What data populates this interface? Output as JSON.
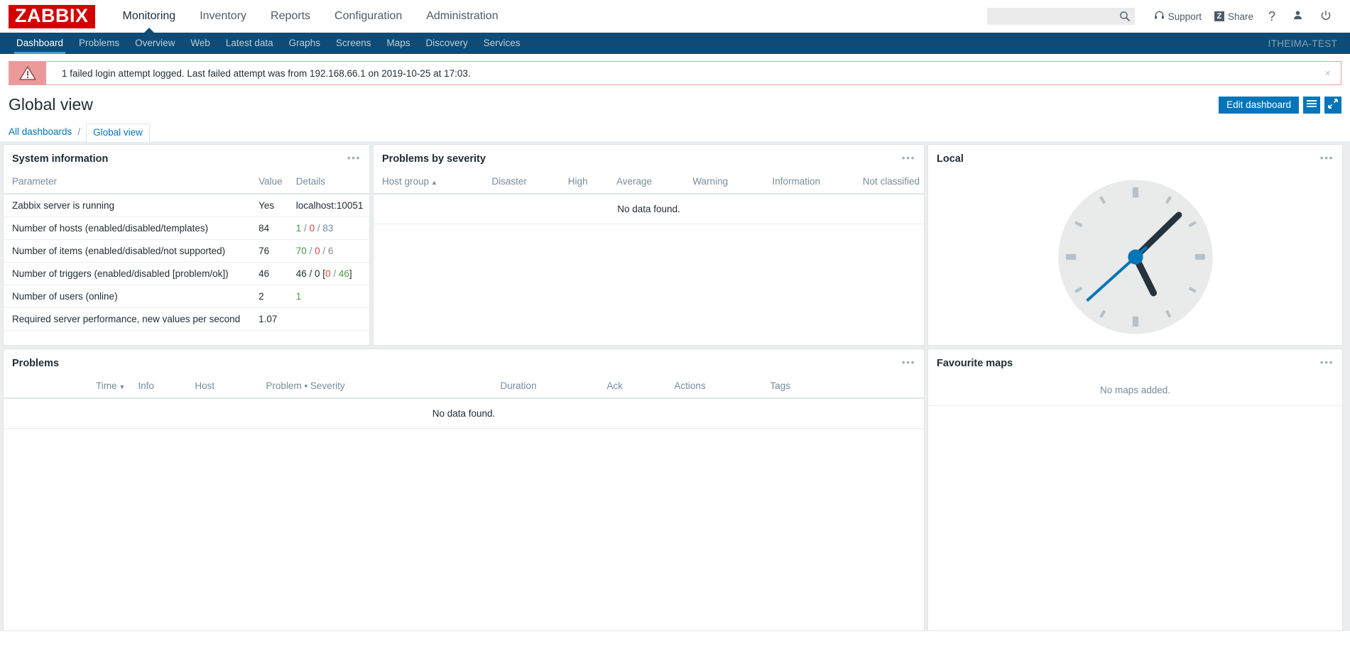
{
  "brand": {
    "logo_text": "ZABBIX"
  },
  "mainnav": {
    "items": [
      {
        "label": "Monitoring",
        "active": true
      },
      {
        "label": "Inventory",
        "active": false
      },
      {
        "label": "Reports",
        "active": false
      },
      {
        "label": "Configuration",
        "active": false
      },
      {
        "label": "Administration",
        "active": false
      }
    ]
  },
  "topright": {
    "search_placeholder": "",
    "search_value": "",
    "search_icon": "search-icon",
    "support_label": "Support",
    "support_icon": "headset-icon",
    "share_label": "Share",
    "share_icon": "z-badge-icon",
    "help_label": "?",
    "user_icon": "user-icon",
    "signout_icon": "power-icon"
  },
  "subnav": {
    "items": [
      {
        "label": "Dashboard",
        "active": true
      },
      {
        "label": "Problems",
        "active": false
      },
      {
        "label": "Overview",
        "active": false
      },
      {
        "label": "Web",
        "active": false
      },
      {
        "label": "Latest data",
        "active": false
      },
      {
        "label": "Graphs",
        "active": false
      },
      {
        "label": "Screens",
        "active": false
      },
      {
        "label": "Maps",
        "active": false
      },
      {
        "label": "Discovery",
        "active": false
      },
      {
        "label": "Services",
        "active": false
      }
    ],
    "server_name": "ITHEIMA-TEST"
  },
  "alert": {
    "icon": "warning-triangle-icon",
    "message": "1 failed login attempt logged. Last failed attempt was from 192.168.66.1 on 2019-10-25 at 17:03.",
    "close_label": "×"
  },
  "page": {
    "title": "Global view",
    "edit_button": "Edit dashboard",
    "menu_icon": "hamburger-menu-icon",
    "kiosk_icon": "expand-arrows-icon"
  },
  "breadcrumb": {
    "all_dashboards": "All dashboards",
    "separator": "/",
    "current": "Global view"
  },
  "widgets": {
    "system_information": {
      "title": "System information",
      "menu_icon": "widget-menu-icon",
      "columns": [
        "Parameter",
        "Value",
        "Details"
      ],
      "rows": [
        {
          "parameter": "Zabbix server is running",
          "value": "Yes",
          "value_color": "green",
          "details": [
            {
              "text": "localhost:10051",
              "color": "dark"
            }
          ]
        },
        {
          "parameter": "Number of hosts (enabled/disabled/templates)",
          "value": "84",
          "value_color": "dark",
          "details": [
            {
              "text": "1",
              "color": "green"
            },
            {
              "text": " / ",
              "color": "gray"
            },
            {
              "text": "0",
              "color": "red"
            },
            {
              "text": " / ",
              "color": "gray"
            },
            {
              "text": "83",
              "color": "gray"
            }
          ]
        },
        {
          "parameter": "Number of items (enabled/disabled/not supported)",
          "value": "76",
          "value_color": "dark",
          "details": [
            {
              "text": "70",
              "color": "green"
            },
            {
              "text": " / ",
              "color": "gray"
            },
            {
              "text": "0",
              "color": "red"
            },
            {
              "text": " / ",
              "color": "gray"
            },
            {
              "text": "6",
              "color": "gray"
            }
          ]
        },
        {
          "parameter": "Number of triggers (enabled/disabled [problem/ok])",
          "value": "46",
          "value_color": "dark",
          "details": [
            {
              "text": "46 / 0 [",
              "color": "dark"
            },
            {
              "text": "0",
              "color": "red"
            },
            {
              "text": " / ",
              "color": "gray"
            },
            {
              "text": "46",
              "color": "green"
            },
            {
              "text": "]",
              "color": "dark"
            }
          ]
        },
        {
          "parameter": "Number of users (online)",
          "value": "2",
          "value_color": "dark",
          "details": [
            {
              "text": "1",
              "color": "green"
            }
          ]
        },
        {
          "parameter": "Required server performance, new values per second",
          "value": "1.07",
          "value_color": "dark",
          "details": []
        }
      ]
    },
    "problems_by_severity": {
      "title": "Problems by severity",
      "menu_icon": "widget-menu-icon",
      "columns": [
        {
          "label": "Host group",
          "sorted": "asc",
          "sort_glyph": "▲"
        },
        {
          "label": "Disaster",
          "sorted": "",
          "sort_glyph": ""
        },
        {
          "label": "High",
          "sorted": "",
          "sort_glyph": ""
        },
        {
          "label": "Average",
          "sorted": "",
          "sort_glyph": ""
        },
        {
          "label": "Warning",
          "sorted": "",
          "sort_glyph": ""
        },
        {
          "label": "Information",
          "sorted": "",
          "sort_glyph": ""
        },
        {
          "label": "Not classified",
          "sorted": "",
          "sort_glyph": ""
        }
      ],
      "empty_text": "No data found.",
      "rows": []
    },
    "local_clock": {
      "title": "Local",
      "menu_icon": "widget-menu-icon",
      "clock": {
        "hour": 5,
        "minute": 7,
        "second": 38
      }
    },
    "problems": {
      "title": "Problems",
      "menu_icon": "widget-menu-icon",
      "columns": [
        {
          "label": "Time",
          "sorted": "desc",
          "sort_glyph": "▼"
        },
        {
          "label": "Info",
          "sorted": "",
          "sort_glyph": ""
        },
        {
          "label": "Host",
          "sorted": "",
          "sort_glyph": ""
        },
        {
          "label": "Problem • Severity",
          "sorted": "",
          "sort_glyph": ""
        },
        {
          "label": "Duration",
          "sorted": "",
          "sort_glyph": ""
        },
        {
          "label": "Ack",
          "sorted": "",
          "sort_glyph": ""
        },
        {
          "label": "Actions",
          "sorted": "",
          "sort_glyph": ""
        },
        {
          "label": "Tags",
          "sorted": "",
          "sort_glyph": ""
        }
      ],
      "empty_text": "No data found.",
      "rows": []
    },
    "favourite_maps": {
      "title": "Favourite maps",
      "menu_icon": "widget-menu-icon",
      "empty_text": "No maps added."
    }
  },
  "colors": {
    "brand_red": "#d40000",
    "nav_blue": "#0f4b75",
    "accent_blue": "#0275b8",
    "link_blue": "#0275b8",
    "alert_pink": "#eb9a9a",
    "green": "#4a9a4a",
    "red": "#d44",
    "gray": "#768d9c",
    "clock_face": "#e9eaea",
    "clock_hand": "#26333d",
    "clock_second": "#0275b8"
  }
}
